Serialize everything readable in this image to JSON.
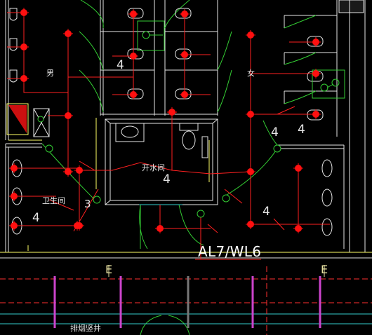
{
  "drawing": {
    "background": "#000000",
    "colors": {
      "wall": "#e6e6e6",
      "fixture": "#e6e6e6",
      "door": "#33cc33",
      "wire": "#ff2020",
      "lamp_fill": "#ff1010",
      "ventilator": "#33cc33",
      "room_label": "#e6e6e6",
      "circuit_label": "#ffffff",
      "axis_label": "#e6e0a0",
      "axis_line": "#ff3030",
      "column": "#cc44cc",
      "pipe": "#33cccc",
      "partition": "#ffff66"
    },
    "labels": {
      "men": "男",
      "women": "女",
      "open_room": "开水间",
      "washroom": "卫生间",
      "shaft": "排烟竖井",
      "circuit": "AL7/WL6",
      "axis_left": "E",
      "axis_right": "E"
    },
    "wire_count_marks": [
      "4",
      "4",
      "4",
      "4",
      "4",
      "4",
      "3"
    ],
    "symbols": {
      "ceiling_lamp": "ceiling-lamp-icon",
      "exhaust_fan": "exhaust-fan-icon",
      "switch": "switch-icon",
      "urinal": "urinal-icon",
      "washbasin": "washbasin-icon",
      "squat_toilet": "squat-toilet-icon",
      "sitting_toilet": "sitting-toilet-icon",
      "panel": "distribution-panel-icon"
    }
  }
}
